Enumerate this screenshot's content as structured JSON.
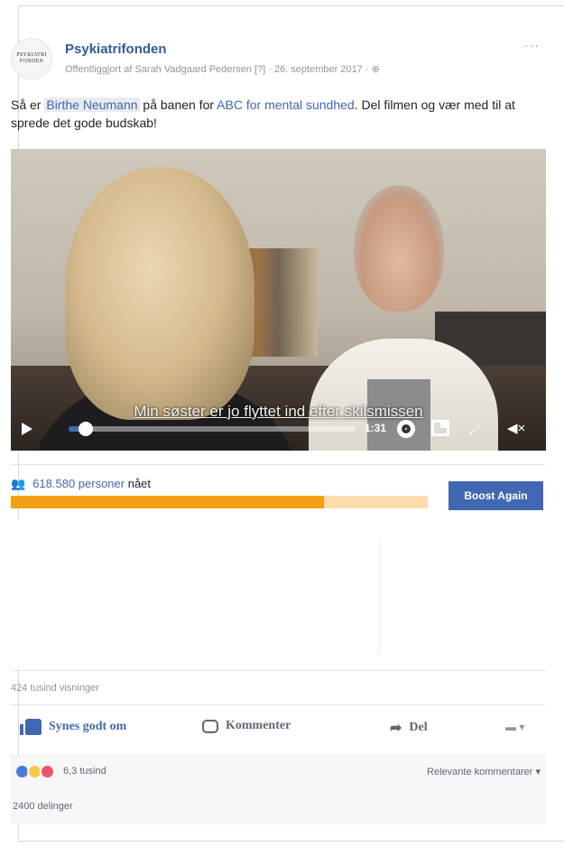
{
  "post": {
    "page_name": "Psykiatrifonden",
    "meta": "Offentliggjort af Sarah Vadgaard Pedersen [?] · 26. september 2017 · ",
    "privacy_icon": "globe-icon",
    "more": "···",
    "avatar_logo_top": "PSYKIATRI",
    "avatar_logo_mid": "FONDEN",
    "text_before": "Så er ",
    "tag": "Birthe Neumann",
    "text_mid": " på banen for ",
    "link": "ABC for mental sundhed",
    "text_after": ". Del filmen og vær med til at sprede det gode budskab!"
  },
  "video": {
    "subtitle": "Min søster er jo flyttet ind efter skilsmissen",
    "time": "1:31",
    "progress": 0.06,
    "icons": {
      "play": "play-icon",
      "settings": "gear-icon",
      "pip": "picture-in-picture-icon",
      "fullscreen": "fullscreen-icon",
      "volume": "muted-volume-icon"
    }
  },
  "insights": {
    "reach_number": "618.580 personer",
    "reach_suffix": " nået",
    "reach_progress": 0.75,
    "boost_label": "Boost Again",
    "colors": {
      "reach_fill": "#f3a112",
      "reach_bg": "#fbdcaa",
      "boost": "#4267b2"
    }
  },
  "stats": {
    "views": "424 tusind visninger"
  },
  "actions": {
    "like": "Synes godt om",
    "comment": "Kommenter",
    "share": "Del",
    "reaction_picker": "▾"
  },
  "reactions": {
    "count": "6,3 tusind",
    "sort": "Relevante kommentarer ▾"
  },
  "shares": {
    "text": "2400 delinger"
  }
}
